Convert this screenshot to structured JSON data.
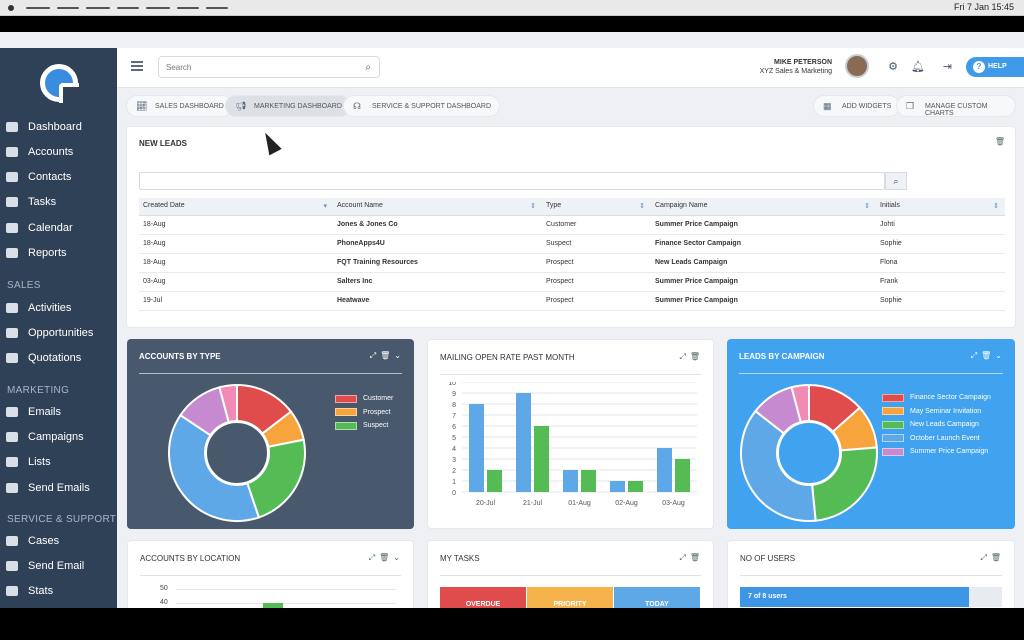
{
  "os": {
    "clock": "Fri 7 Jan  15:45"
  },
  "sidebar": {
    "items": [
      {
        "label": "Dashboard"
      },
      {
        "label": "Accounts"
      },
      {
        "label": "Contacts"
      },
      {
        "label": "Tasks"
      },
      {
        "label": "Calendar"
      },
      {
        "label": "Reports"
      }
    ],
    "sales_heading": "SALES",
    "sales": [
      {
        "label": "Activities"
      },
      {
        "label": "Opportunities"
      },
      {
        "label": "Quotations"
      }
    ],
    "marketing_heading": "MARKETING",
    "marketing": [
      {
        "label": "Emails"
      },
      {
        "label": "Campaigns"
      },
      {
        "label": "Lists"
      },
      {
        "label": "Send Emails"
      }
    ],
    "support_heading": "SERVICE & SUPPORT",
    "support": [
      {
        "label": "Cases"
      },
      {
        "label": "Send Email"
      },
      {
        "label": "Stats"
      }
    ]
  },
  "header": {
    "search_placeholder": "Search",
    "user_name": "MIKE PETERSON",
    "user_company": "XYZ Sales & Marketing",
    "help_label": "HELP"
  },
  "tabs": {
    "sales": "SALES DASHBOARD",
    "marketing": "MARKETING DASHBOARD",
    "service": "SERVICE & SUPPORT DASHBOARD",
    "add_widgets": "ADD WIDGETS",
    "manage_charts": "MANAGE CUSTOM CHARTS"
  },
  "new_leads": {
    "title": "NEW LEADS",
    "columns": [
      "Created Date",
      "Account Name",
      "Type",
      "Campaign Name",
      "Initials"
    ],
    "rows": [
      [
        "18-Aug",
        "Jones & Jones Co",
        "Customer",
        "Summer Price Campaign",
        "Johti"
      ],
      [
        "18-Aug",
        "PhoneApps4U",
        "Suspect",
        "Finance Sector Campaign",
        "Sophie"
      ],
      [
        "18-Aug",
        "FQT Training Resources",
        "Prospect",
        "New Leads Campaign",
        "Flona"
      ],
      [
        "03-Aug",
        "Salters Inc",
        "Prospect",
        "Summer Price Campaign",
        "Frank"
      ],
      [
        "19-Jul",
        "Heatwave",
        "Prospect",
        "Summer Price Campaign",
        "Sophie"
      ]
    ]
  },
  "widgets": {
    "accounts_by_type": "ACCOUNTS BY TYPE",
    "mailing_rate": "MAILING OPEN RATE PAST MONTH",
    "leads_by_campaign": "LEADS BY CAMPAIGN",
    "accounts_by_location": "ACCOUNTS BY LOCATION",
    "my_tasks": "MY TASKS",
    "no_of_users": "NO OF USERS",
    "users_bar": "7 of 8 users",
    "task_tabs": [
      "OVERDUE",
      "PRIORITY",
      "TODAY"
    ],
    "location_ticks": [
      "50",
      "40"
    ]
  },
  "chart_data": [
    {
      "type": "pie",
      "categories": [
        "Customer",
        "Prospect",
        "Suspect"
      ],
      "legend": [
        "Customer",
        "Prospect",
        "Suspect"
      ],
      "colors": [
        "#e04b4b",
        "#f6a43b",
        "#55bb55",
        "#5fa8e8",
        "#c58ad0",
        "#f28bb4"
      ],
      "values": [
        14,
        7,
        22,
        38,
        11,
        4
      ],
      "legend_placement": "right"
    },
    {
      "type": "bar",
      "categories": [
        "20-Jul",
        "21-Jul",
        "01-Aug",
        "02-Aug",
        "03-Aug"
      ],
      "series": [
        {
          "values": [
            8,
            9,
            2,
            1,
            4
          ],
          "color": "#5fa8e8"
        },
        {
          "values": [
            2,
            6,
            2,
            1,
            3
          ],
          "color": "#55bb55"
        }
      ],
      "ylim": [
        0,
        10
      ],
      "yticks": [
        "0",
        "1",
        "2",
        "3",
        "4",
        "5",
        "6",
        "7",
        "8",
        "9",
        "10"
      ],
      "grid": true
    },
    {
      "type": "pie",
      "legend": [
        "Finance Sector Campaign",
        "May Seminar Invitation",
        "New Leads Campaign",
        "October Launch Event",
        "Summer Price Campaign"
      ],
      "colors": [
        "#e04b4b",
        "#f6a43b",
        "#55bb55",
        "#5fa8e8",
        "#c58ad0",
        "#f28bb4"
      ],
      "values": [
        13,
        10,
        24,
        36,
        10,
        4
      ],
      "legend_placement": "right"
    }
  ]
}
